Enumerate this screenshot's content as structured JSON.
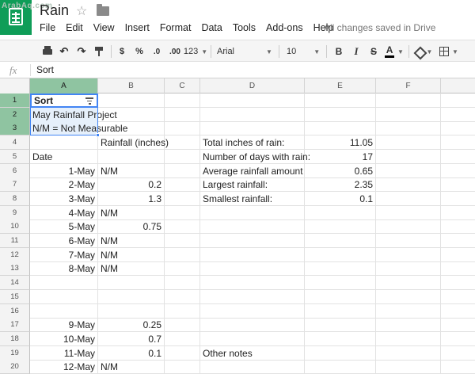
{
  "watermark": "ArabAq.com",
  "doc": {
    "title": "Rain",
    "save_status": "All changes saved in Drive"
  },
  "menu": [
    "File",
    "Edit",
    "View",
    "Insert",
    "Format",
    "Data",
    "Tools",
    "Add-ons",
    "Help"
  ],
  "toolbar": {
    "currency": "$",
    "percent": "%",
    "decrease_decimal": ".0",
    "increase_decimal": ".00",
    "more_formats": "123",
    "font": "Arial",
    "font_size": "10",
    "bold": "B",
    "italic": "I",
    "strike": "S",
    "text_color": "A"
  },
  "formula": {
    "fx": "fx",
    "value": "Sort"
  },
  "columns": [
    "A",
    "B",
    "C",
    "D",
    "E",
    "F"
  ],
  "rows": [
    {
      "n": "1",
      "a": "Sort",
      "b": "",
      "d": "",
      "e": ""
    },
    {
      "n": "2",
      "a": "May Rainfall Project",
      "b": "",
      "d": "",
      "e": ""
    },
    {
      "n": "3",
      "a": "N/M = Not Measurable",
      "b": "",
      "d": "",
      "e": ""
    },
    {
      "n": "4",
      "a": "",
      "b": "Rainfall (inches)",
      "d": "Total inches of rain:",
      "e": "11.05"
    },
    {
      "n": "5",
      "a": "Date",
      "b": "",
      "d": "Number of days with rain:",
      "e": "17"
    },
    {
      "n": "6",
      "a": "1-May",
      "b": "N/M",
      "d": "Average rainfall amount",
      "e": "0.65"
    },
    {
      "n": "7",
      "a": "2-May",
      "b": "0.2",
      "d": "Largest rainfall:",
      "e": "2.35"
    },
    {
      "n": "8",
      "a": "3-May",
      "b": "1.3",
      "d": "Smallest rainfall:",
      "e": "0.1"
    },
    {
      "n": "9",
      "a": "4-May",
      "b": "N/M",
      "d": "",
      "e": ""
    },
    {
      "n": "10",
      "a": "5-May",
      "b": "0.75",
      "d": "",
      "e": ""
    },
    {
      "n": "11",
      "a": "6-May",
      "b": "N/M",
      "d": "",
      "e": ""
    },
    {
      "n": "12",
      "a": "7-May",
      "b": "N/M",
      "d": "",
      "e": ""
    },
    {
      "n": "13",
      "a": "8-May",
      "b": "N/M",
      "d": "",
      "e": ""
    },
    {
      "n": "14",
      "a": "",
      "b": "",
      "d": "",
      "e": ""
    },
    {
      "n": "15",
      "a": "",
      "b": "",
      "d": "",
      "e": ""
    },
    {
      "n": "16",
      "a": "",
      "b": "",
      "d": "",
      "e": ""
    },
    {
      "n": "17",
      "a": "9-May",
      "b": "0.25",
      "d": "",
      "e": ""
    },
    {
      "n": "18",
      "a": "10-May",
      "b": "0.7",
      "d": "",
      "e": ""
    },
    {
      "n": "19",
      "a": "11-May",
      "b": "0.1",
      "d": "Other notes",
      "e": ""
    },
    {
      "n": "20",
      "a": "12-May",
      "b": "N/M",
      "d": "",
      "e": ""
    }
  ]
}
